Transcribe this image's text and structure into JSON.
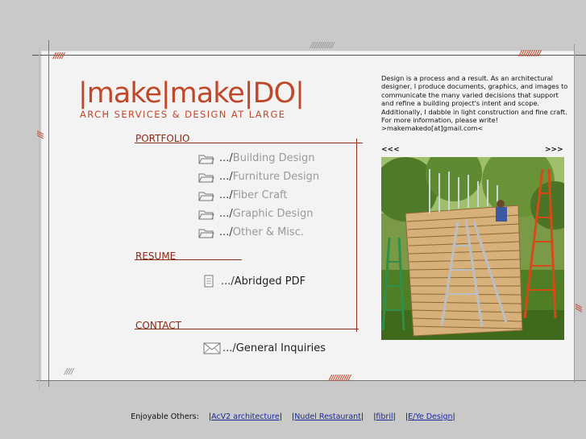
{
  "logo": {
    "title": "|make|make|DO|",
    "subtitle": "ARCH SERVICES & DESIGN AT LARGE"
  },
  "portfolio": {
    "heading": "PORTFOLIO",
    "items": [
      {
        "prefix": ".../",
        "label": "Building Design",
        "icon": "folder-icon"
      },
      {
        "prefix": ".../",
        "label": "Furniture Design",
        "icon": "folder-icon"
      },
      {
        "prefix": ".../",
        "label": "Fiber Craft",
        "icon": "folder-icon"
      },
      {
        "prefix": ".../",
        "label": "Graphic Design",
        "icon": "folder-icon"
      },
      {
        "prefix": ".../",
        "label": "Other & Misc.",
        "icon": "folder-icon"
      }
    ]
  },
  "resume": {
    "heading": "RESUME",
    "item": {
      "prefix": ".../",
      "label": "Abridged PDF",
      "icon": "document-icon"
    }
  },
  "contact": {
    "heading": "CONTACT",
    "item": {
      "prefix": ".../",
      "label": "General Inquiries",
      "icon": "envelope-icon"
    }
  },
  "intro": {
    "text": "Design is a process and a result. As an architectural designer, I produce documents, graphics, and images to communicate the many varied decisions that support and refine a building project's intent and scope. Additionally, I dabble in light construction and fine craft. For more information, please write!",
    "email": ">makemakedo[at]gmail.com<"
  },
  "gallery": {
    "prev": "<<<",
    "next": ">>>"
  },
  "footer": {
    "label": "Enjoyable Others:",
    "links": [
      "AcV2 architecture",
      "Nudel Restaurant",
      "fibril",
      "E/Ye Design"
    ]
  },
  "colors": {
    "accent": "#c0482a",
    "rule": "#8b2a14",
    "background": "#c9c9c9",
    "sheet": "#f3f3f3"
  }
}
